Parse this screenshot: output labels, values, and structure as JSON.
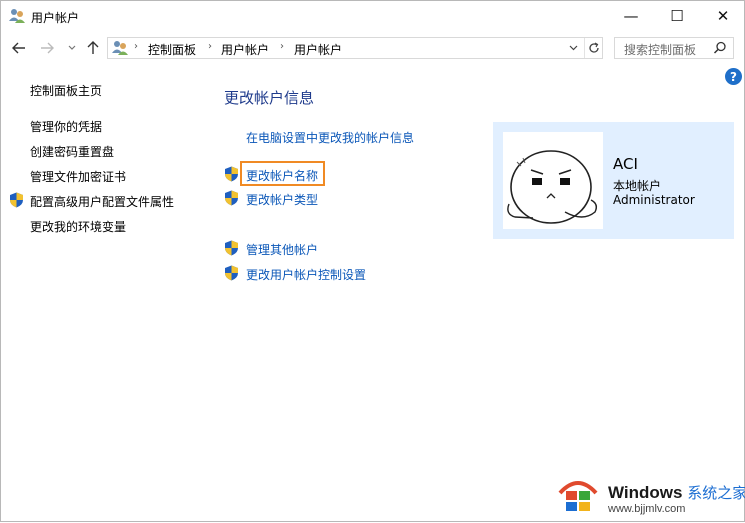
{
  "window": {
    "title": "用户帐户",
    "controls": {
      "minimize": "—",
      "maximize": "☐",
      "close": "✕"
    }
  },
  "nav": {
    "back_icon": "arrow-left-icon",
    "forward_icon": "arrow-right-icon",
    "up_icon": "arrow-up-icon",
    "breadcrumbs": [
      "控制面板",
      "用户帐户",
      "用户帐户"
    ],
    "search_placeholder": "搜索控制面板"
  },
  "sidebar": {
    "home": "控制面板主页",
    "items": [
      {
        "label": "管理你的凭据",
        "shield": false
      },
      {
        "label": "创建密码重置盘",
        "shield": false
      },
      {
        "label": "管理文件加密证书",
        "shield": false
      },
      {
        "label": "配置高级用户配置文件属性",
        "shield": true
      },
      {
        "label": "更改我的环境变量",
        "shield": false
      }
    ]
  },
  "main": {
    "heading": "更改帐户信息",
    "pc_settings_link": "在电脑设置中更改我的帐户信息",
    "links": [
      {
        "label": "更改帐户名称",
        "shield": true,
        "highlighted": true
      },
      {
        "label": "更改帐户类型",
        "shield": true
      },
      {
        "label": "管理其他帐户",
        "shield": true
      },
      {
        "label": "更改用户帐户控制设置",
        "shield": true
      }
    ]
  },
  "account": {
    "name": "ACI",
    "type": "本地帐户",
    "role": "Administrator"
  },
  "watermark": {
    "brand": "Windows",
    "cn": "系统之家",
    "url": "www.bjjmlv.com"
  },
  "colors": {
    "link": "#0b57b8",
    "heading": "#1f3b8c",
    "panel_bg": "#e1efff",
    "highlight": "#f08a24"
  }
}
